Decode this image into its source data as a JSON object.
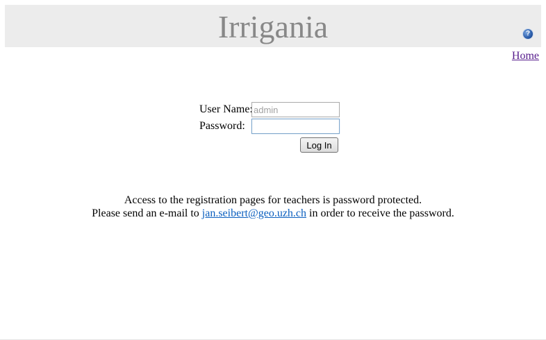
{
  "header": {
    "title": "Irrigania",
    "help_glyph": "?"
  },
  "nav": {
    "home_label": "Home"
  },
  "login": {
    "username_label": "User Name:",
    "username_placeholder": "admin",
    "password_label": "Password:",
    "password_value": "",
    "submit_label": "Log In"
  },
  "info": {
    "line1": "Access to the registration pages for teachers is password protected.",
    "line2_prefix": "Please send an e-mail to ",
    "email": "jan.seibert@geo.uzh.ch",
    "line2_suffix": " in order to receive the password."
  },
  "icons": {
    "help": "help-icon"
  },
  "colors": {
    "header_bg": "#ececec",
    "title": "#888888",
    "visited_link": "#551a8b",
    "link": "#0b5fbf"
  }
}
